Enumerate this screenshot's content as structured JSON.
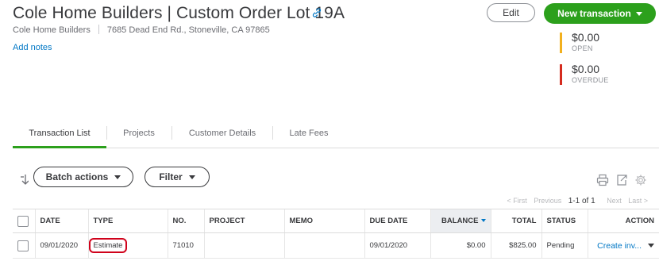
{
  "header": {
    "title": "Cole Home Builders | Custom Order Lot 19A",
    "customer": "Cole Home Builders",
    "address": "7685 Dead End Rd., Stoneville, CA 97865",
    "add_notes": "Add notes",
    "edit_label": "Edit",
    "new_transaction_label": "New transaction"
  },
  "stats": [
    {
      "amount": "$0.00",
      "label": "OPEN",
      "color": "#f2b01e"
    },
    {
      "amount": "$0.00",
      "label": "OVERDUE",
      "color": "#d52b1e"
    }
  ],
  "tabs": [
    {
      "label": "Transaction List",
      "active": true
    },
    {
      "label": "Projects"
    },
    {
      "label": "Customer Details"
    },
    {
      "label": "Late Fees"
    }
  ],
  "toolbar": {
    "batch_actions": "Batch actions",
    "filter": "Filter"
  },
  "pager": {
    "first": "< First",
    "previous": "Previous",
    "range": "1-1 of 1",
    "next": "Next",
    "last": "Last >"
  },
  "table": {
    "headers": [
      "DATE",
      "TYPE",
      "NO.",
      "PROJECT",
      "MEMO",
      "DUE DATE",
      "BALANCE",
      "TOTAL",
      "STATUS",
      "ACTION"
    ],
    "rows": [
      {
        "date": "09/01/2020",
        "type": "Estimate",
        "no": "71010",
        "project": "",
        "memo": "",
        "due_date": "09/01/2020",
        "balance": "$0.00",
        "total": "$825.00",
        "status": "Pending",
        "action": "Create inv..."
      }
    ]
  },
  "colors": {
    "accent_green": "#2ca01c",
    "link_blue": "#0077c5",
    "highlight_red": "#d0021b"
  }
}
